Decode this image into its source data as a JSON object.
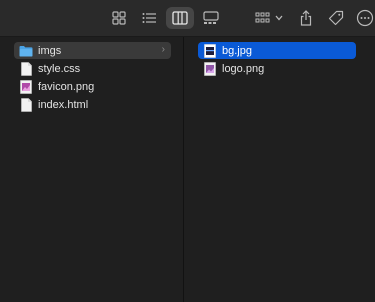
{
  "toolbar": {
    "buttons": [
      {
        "name": "icon-view",
        "icon": "grid-icon"
      },
      {
        "name": "list-view",
        "icon": "list-icon"
      },
      {
        "name": "column-view",
        "icon": "columns-icon",
        "selected": true
      },
      {
        "name": "gallery-view",
        "icon": "gallery-icon"
      },
      {
        "name": "group-by",
        "icon": "group-icon"
      },
      {
        "name": "share",
        "icon": "share-icon"
      },
      {
        "name": "tags",
        "icon": "tag-icon"
      },
      {
        "name": "more",
        "icon": "ellipsis-icon"
      }
    ]
  },
  "columns": [
    {
      "items": [
        {
          "label": "imgs",
          "icon": "folder-icon",
          "state": "parent-selected",
          "has_children": true
        },
        {
          "label": "style.css",
          "icon": "document-icon"
        },
        {
          "label": "favicon.png",
          "icon": "image-file-icon"
        },
        {
          "label": "index.html",
          "icon": "document-icon"
        }
      ]
    },
    {
      "items": [
        {
          "label": "bg.jpg",
          "icon": "image-file-icon",
          "state": "selected"
        },
        {
          "label": "logo.png",
          "icon": "image-file-icon"
        }
      ]
    }
  ],
  "colors": {
    "selection": "#0a5ad6",
    "parent_selection": "#3a3a3a",
    "folder": "#4aa3e6"
  }
}
